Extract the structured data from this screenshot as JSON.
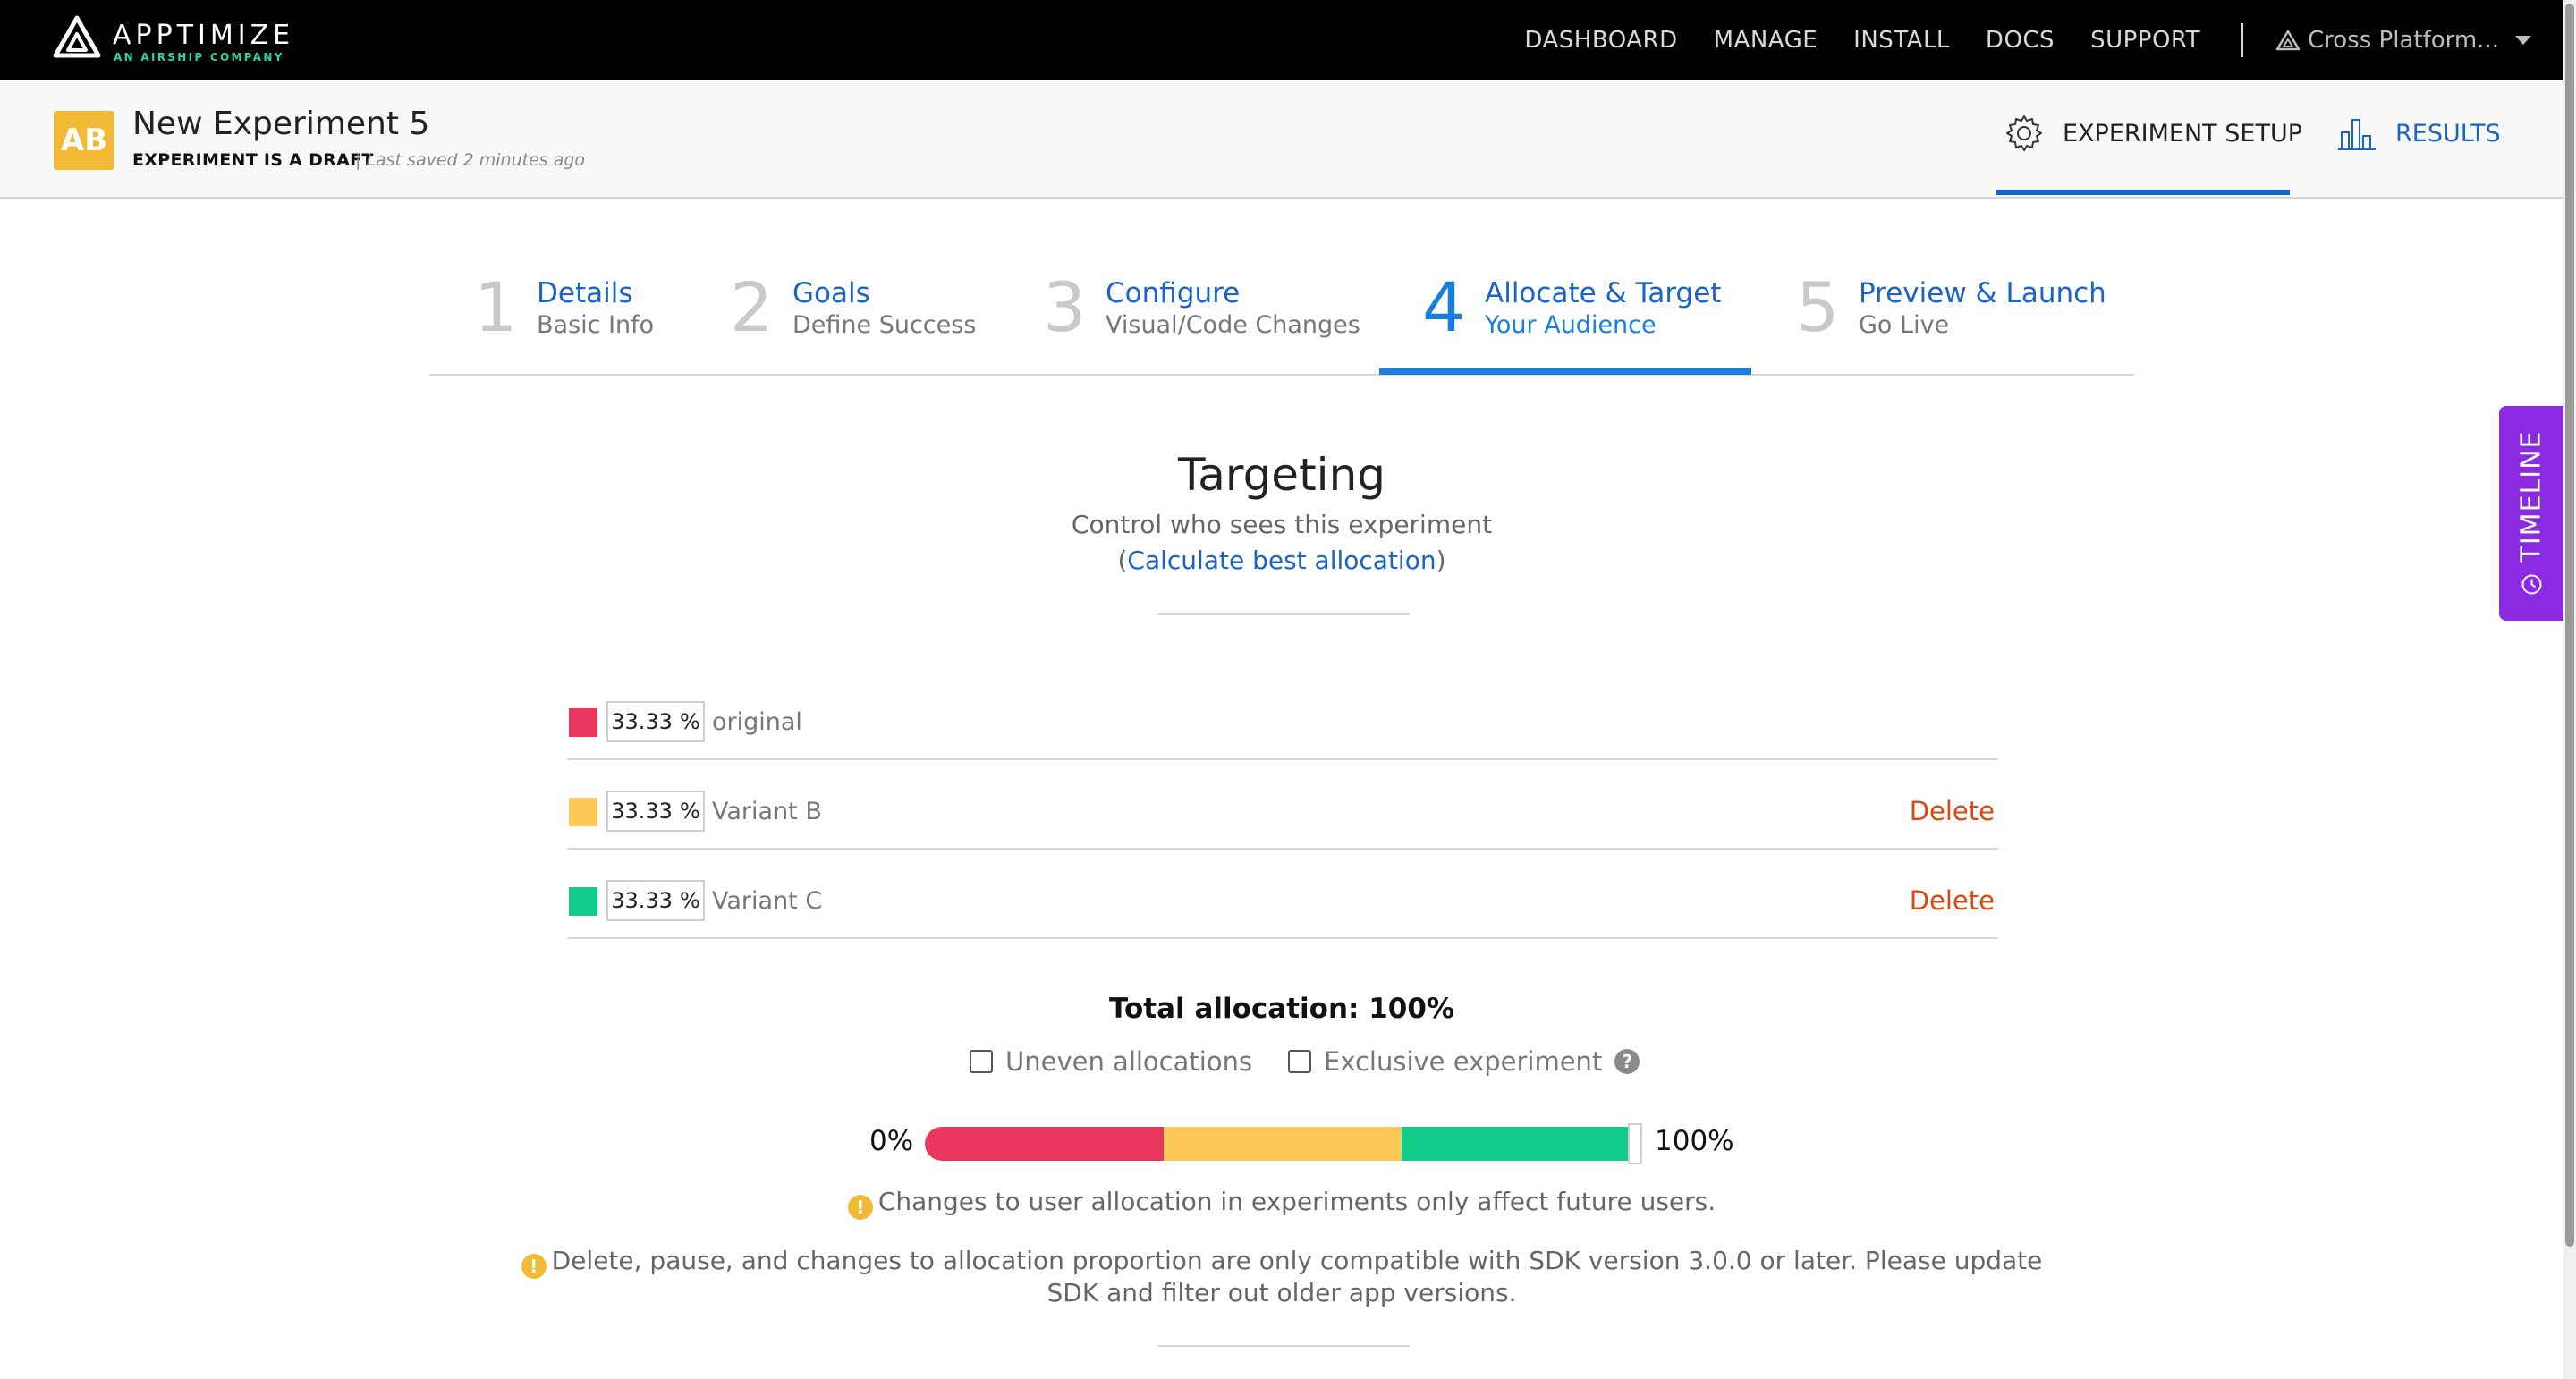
{
  "brand": {
    "name": "APPTIMIZE",
    "tagline": "AN AIRSHIP COMPANY"
  },
  "nav": {
    "links": [
      "DASHBOARD",
      "MANAGE",
      "INSTALL",
      "DOCS",
      "SUPPORT"
    ],
    "platform": "Cross Platform..."
  },
  "experiment": {
    "badge": "AB",
    "title": "New Experiment 5",
    "status": "EXPERIMENT IS A DRAFT",
    "saved": "| Last saved 2 minutes ago"
  },
  "header_tabs": {
    "setup": "EXPERIMENT SETUP",
    "results": "RESULTS"
  },
  "steps": [
    {
      "num": "1",
      "title": "Details",
      "sub": "Basic Info"
    },
    {
      "num": "2",
      "title": "Goals",
      "sub": "Define Success"
    },
    {
      "num": "3",
      "title": "Configure",
      "sub": "Visual/Code Changes"
    },
    {
      "num": "4",
      "title": "Allocate & Target",
      "sub": "Your Audience"
    },
    {
      "num": "5",
      "title": "Preview & Launch",
      "sub": "Go Live"
    }
  ],
  "targeting": {
    "title": "Targeting",
    "subtitle": "Control who sees this experiment",
    "link_open": "(",
    "link": "Calculate best allocation",
    "link_close": ")"
  },
  "variants": [
    {
      "name": "original",
      "percent": "33.33",
      "unit": "%",
      "color": "#e8365e",
      "delete": ""
    },
    {
      "name": "Variant B",
      "percent": "33.33",
      "unit": "%",
      "color": "#fdc857",
      "delete": "Delete"
    },
    {
      "name": "Variant C",
      "percent": "33.33",
      "unit": "%",
      "color": "#13cb8b",
      "delete": "Delete"
    }
  ],
  "total": "Total allocation: 100%",
  "options": {
    "uneven": "Uneven allocations",
    "exclusive": "Exclusive experiment",
    "help": "?"
  },
  "bar": {
    "min_label": "0%",
    "max_label": "100%",
    "fractions": [
      0.3333,
      0.3333,
      0.3333
    ]
  },
  "warnings": {
    "icon": "!",
    "future_users": "Changes to user allocation in experiments only affect future users.",
    "sdk_line1": "Delete, pause, and changes to allocation proportion are only compatible with SDK version 3.0.0 or later. Please update",
    "sdk_line2": "SDK and filter out older app versions."
  },
  "timeline": "TIMELINE"
}
